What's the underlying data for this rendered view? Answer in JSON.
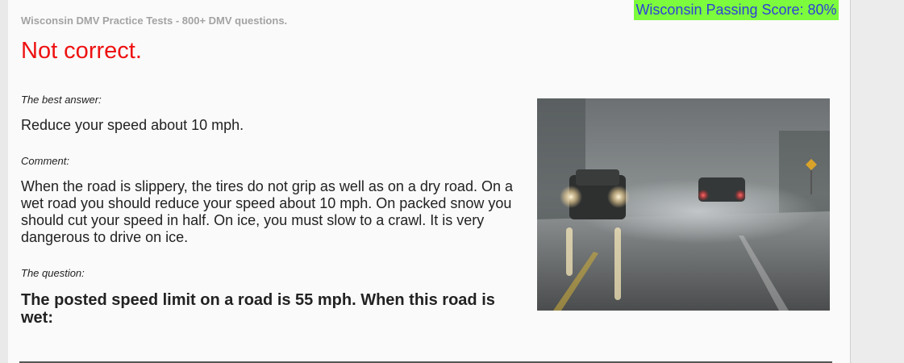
{
  "header": {
    "site_title": "Wisconsin DMV Practice Tests - 800+ DMV questions.",
    "passing_score": "Wisconsin Passing Score: 80%"
  },
  "result": {
    "heading": "Not correct.",
    "color": "#ee1111"
  },
  "answer": {
    "best_label": "The best answer:",
    "best_answer": "Reduce your speed about 10 mph.",
    "comment_label": "Comment:",
    "comment": "When the road is slippery, the tires do not grip as well as on a dry road. On a wet road you should reduce your speed about 10 mph. On packed snow you should cut your speed in half. On ice, you must slow to a crawl. It is very dangerous to drive on ice.",
    "question_label": "The question:",
    "question": "The posted speed limit on a road is 55 mph. When this road is wet:"
  },
  "colors": {
    "badge_background": "#7cfc3c",
    "badge_text": "#2f3fd8"
  }
}
